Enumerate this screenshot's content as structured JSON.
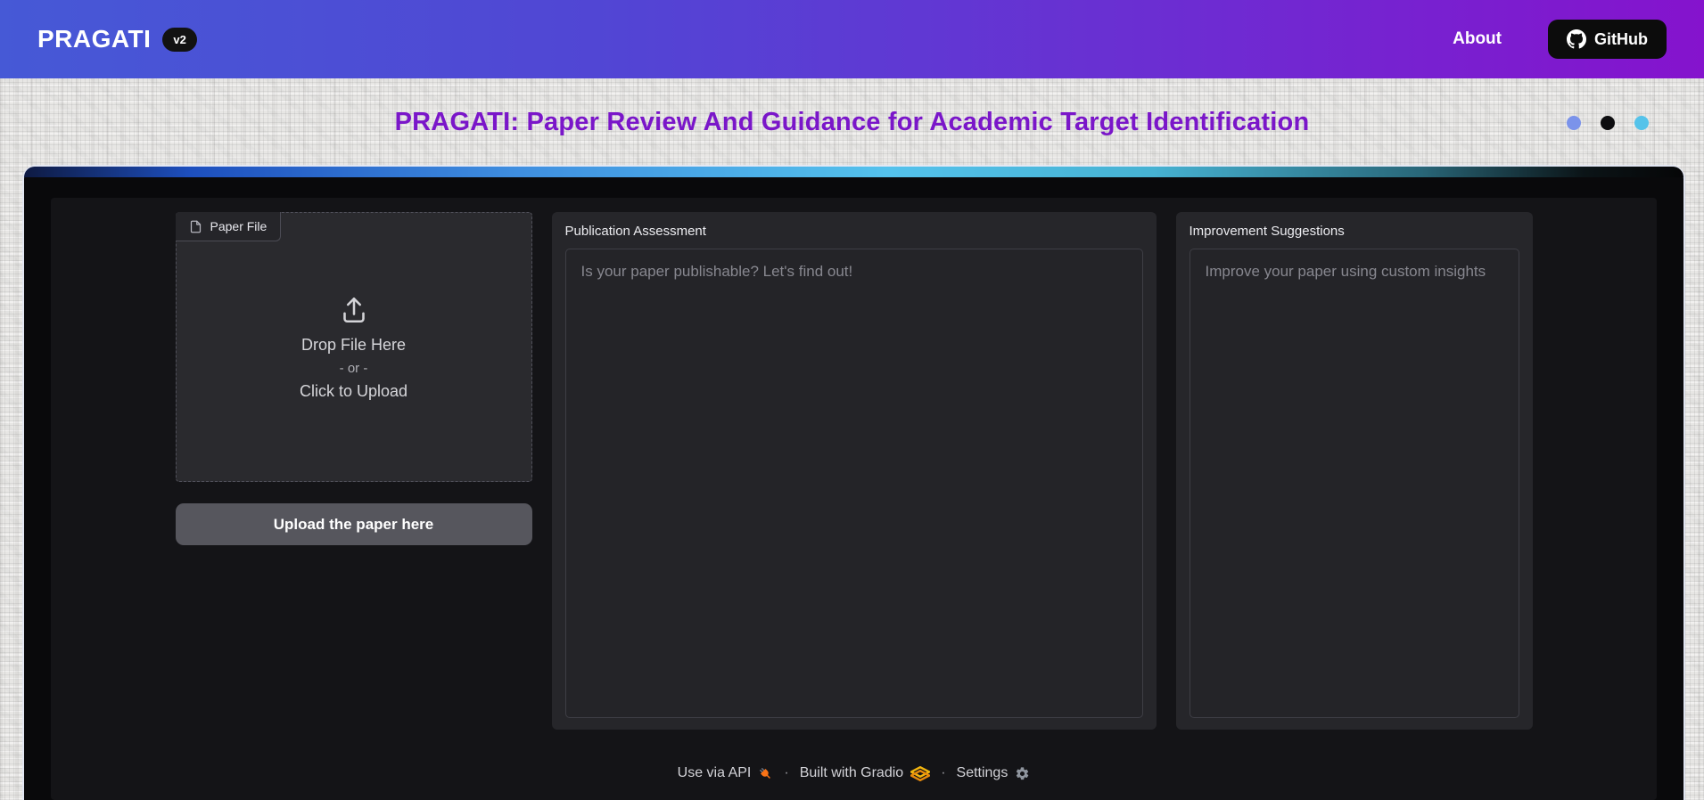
{
  "header": {
    "brand": "PRAGATI",
    "version_badge": "v2",
    "about_label": "About",
    "github_label": "GitHub"
  },
  "title": {
    "text": "PRAGATI: Paper Review And Guidance for Academic Target Identification",
    "dots": [
      {
        "name": "periwinkle-dot",
        "color": "#7b93ea"
      },
      {
        "name": "black-dot",
        "color": "#0d0d0f"
      },
      {
        "name": "cyan-dot",
        "color": "#55c3ea"
      }
    ]
  },
  "upload": {
    "label": "Paper File",
    "drop_text": "Drop File Here",
    "or_text": "- or -",
    "click_text": "Click to Upload",
    "button_label": "Upload the paper here"
  },
  "assessment": {
    "label": "Publication Assessment",
    "placeholder": "Is your paper publishable? Let's find out!"
  },
  "suggestions": {
    "label": "Improvement Suggestions",
    "placeholder": "Improve your paper using custom insights"
  },
  "footer": {
    "api_label": "Use via API",
    "separator": "·",
    "gradio_label": "Built with Gradio",
    "settings_label": "Settings"
  },
  "icons": [
    "github-octocat-icon",
    "file-icon",
    "upload-tray-icon",
    "plug-icon",
    "gradio-logo-icon",
    "gear-icon"
  ],
  "colors": {
    "header_gradient": [
      "#4659d6",
      "#8513cd"
    ],
    "title_text": "#7a16c9",
    "accent_bar": [
      "#0e1a42",
      "#1d4fbe",
      "#54c2ec",
      "#060607"
    ],
    "card_bg": "#09090b",
    "inner_bg": "#141417",
    "panel_bg": "#26262a",
    "upload_box_bg": "#2a2a2e",
    "button_bg": "#56565d",
    "plug_icon": "#f97316",
    "gradio_logo": "#f0a712"
  }
}
